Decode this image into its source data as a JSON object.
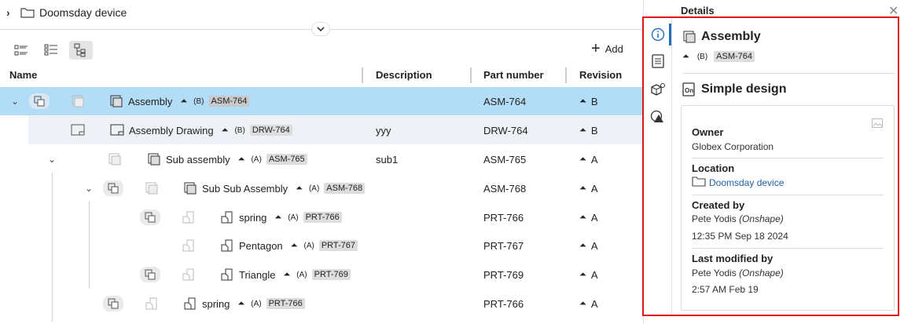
{
  "breadcrumb": {
    "path": "Doomsday device"
  },
  "toolbar": {
    "add_label": "Add"
  },
  "columns": {
    "name": "Name",
    "description": "Description",
    "part_number": "Part number",
    "revision": "Revision"
  },
  "rows": [
    {
      "name": "Assembly",
      "rev": "(B)",
      "id": "ASM-764",
      "description": "",
      "part_number": "ASM-764",
      "revision": "B"
    },
    {
      "name": "Assembly Drawing",
      "rev": "(B)",
      "id": "DRW-764",
      "description": "yyy",
      "part_number": "DRW-764",
      "revision": "B"
    },
    {
      "name": "Sub assembly",
      "rev": "(A)",
      "id": "ASM-765",
      "description": "sub1",
      "part_number": "ASM-765",
      "revision": "A"
    },
    {
      "name": "Sub Sub Assembly",
      "rev": "(A)",
      "id": "ASM-768",
      "description": "",
      "part_number": "ASM-768",
      "revision": "A"
    },
    {
      "name": "spring",
      "rev": "(A)",
      "id": "PRT-766",
      "description": "",
      "part_number": "PRT-766",
      "revision": "A"
    },
    {
      "name": "Pentagon",
      "rev": "(A)",
      "id": "PRT-767",
      "description": "",
      "part_number": "PRT-767",
      "revision": "A"
    },
    {
      "name": "Triangle",
      "rev": "(A)",
      "id": "PRT-769",
      "description": "",
      "part_number": "PRT-769",
      "revision": "A"
    },
    {
      "name": "spring",
      "rev": "(A)",
      "id": "PRT-766",
      "description": "",
      "part_number": "PRT-766",
      "revision": "A"
    }
  ],
  "details": {
    "panel_title": "Details",
    "title": "Assembly",
    "rev": "(B)",
    "id": "ASM-764",
    "subtitle": "Simple design",
    "owner_label": "Owner",
    "owner": "Globex Corporation",
    "location_label": "Location",
    "location": "Doomsday device",
    "created_label": "Created by",
    "created_by": "Pete Yodis",
    "created_org": "(Onshape)",
    "created_time": "12:35 PM Sep 18 2024",
    "modified_label": "Last modified by",
    "modified_by": "Pete Yodis",
    "modified_org": "(Onshape)",
    "modified_time": "2:57 AM Feb 19"
  },
  "colors": {
    "selected_row": "#b3dcf6",
    "alt_row": "#eef1f5",
    "highlight_border": "#e0141e",
    "link": "#1f5fa8"
  }
}
